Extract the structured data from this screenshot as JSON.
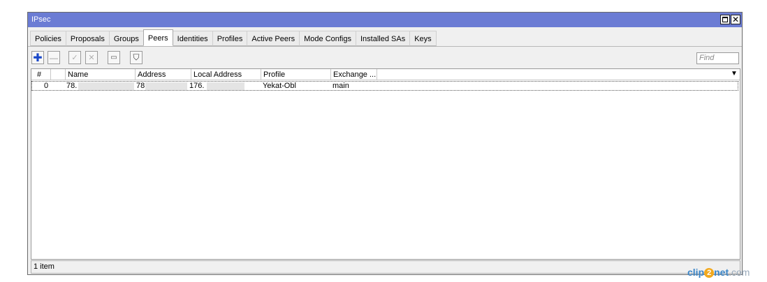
{
  "window": {
    "title": "IPsec"
  },
  "tabs": [
    {
      "label": "Policies",
      "active": false
    },
    {
      "label": "Proposals",
      "active": false
    },
    {
      "label": "Groups",
      "active": false
    },
    {
      "label": "Peers",
      "active": true
    },
    {
      "label": "Identities",
      "active": false
    },
    {
      "label": "Profiles",
      "active": false
    },
    {
      "label": "Active Peers",
      "active": false
    },
    {
      "label": "Mode Configs",
      "active": false
    },
    {
      "label": "Installed SAs",
      "active": false
    },
    {
      "label": "Keys",
      "active": false
    }
  ],
  "toolbar": {
    "add_glyph": "✚",
    "remove_glyph": "—",
    "enable_glyph": "✓",
    "disable_glyph": "✕",
    "comment_glyph": "▭",
    "filter_glyph": "⛉",
    "find_placeholder": "Find"
  },
  "grid": {
    "columns": [
      "#",
      "Name",
      "Address",
      "Local Address",
      "Profile",
      "Exchange ..."
    ],
    "rows": [
      {
        "num": "0",
        "name": "78.",
        "address": "78.",
        "local_address": "176.",
        "profile": "Yekat-Obl",
        "exchange": "main"
      }
    ]
  },
  "status": {
    "text": "1 item"
  },
  "watermark": {
    "pre": "clip",
    "two": "2",
    "post": "net",
    "dom": ".com"
  },
  "icons": {
    "add": "plus-icon",
    "remove": "minus-icon",
    "enable": "check-icon",
    "disable": "cross-icon",
    "comment": "comment-icon",
    "filter": "filter-icon",
    "sort": "dropdown-arrow-icon"
  },
  "colors": {
    "titlebar": "#6b7cd4",
    "add_icon": "#1947c8"
  }
}
